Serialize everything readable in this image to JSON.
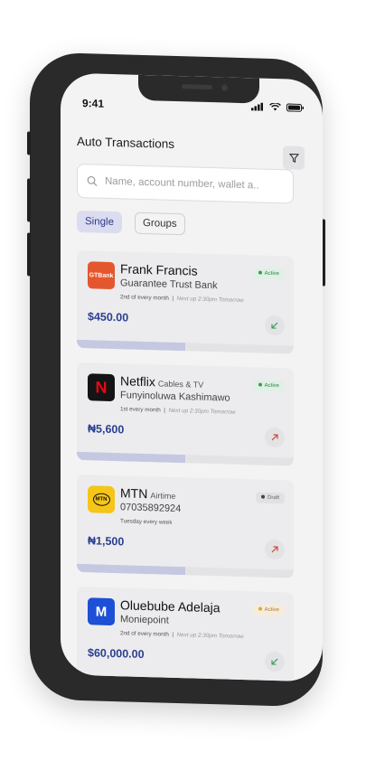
{
  "status": {
    "time": "9:41"
  },
  "header": {
    "title": "Auto Transactions"
  },
  "search": {
    "placeholder": "Name, account number, wallet a.."
  },
  "tabs": [
    {
      "label": "Single"
    },
    {
      "label": "Groups"
    }
  ],
  "cards": [
    {
      "name": "Frank Francis",
      "category": "",
      "subtitle": "Guarantee Trust Bank",
      "schedule": "2nd of every month",
      "next": "Next up 2:30pm Tomorrow",
      "amount": "$450.00",
      "status": "Active",
      "direction": "incoming",
      "progress": 0.5,
      "logo_text": "GTBank",
      "logo_color": "#e4572e"
    },
    {
      "name": "Netflix",
      "category": "Cables & TV",
      "subtitle": "Funyinoluwa Kashimawo",
      "schedule": "1st every month",
      "next": "Next up 2:30pm Tomorrow",
      "amount": "₦5,600",
      "status": "Active",
      "direction": "outgoing",
      "progress": 0.5,
      "logo_text": "N",
      "logo_color": "#141414"
    },
    {
      "name": "MTN",
      "category": "Airtime",
      "subtitle": "07035892924",
      "schedule": "Tuesday every week",
      "next": "",
      "amount": "₦1,500",
      "status": "Draft",
      "direction": "outgoing",
      "progress": 0.5,
      "logo_text": "MTN",
      "logo_color": "#f5c518"
    },
    {
      "name": "Oluebube Adelaja",
      "category": "",
      "subtitle": "Moniepoint",
      "schedule": "2nd of every month",
      "next": "Next up 2:30pm Tomorrow",
      "amount": "$60,000.00",
      "status": "Active",
      "direction": "incoming",
      "progress": 0.5,
      "logo_text": "M",
      "logo_color": "#1d4fd7"
    }
  ],
  "colors": {
    "accent": "#2b3f8f",
    "active_green": "#2f7d45",
    "outgoing_red": "#d4473d",
    "incoming_green": "#3d9a52"
  }
}
